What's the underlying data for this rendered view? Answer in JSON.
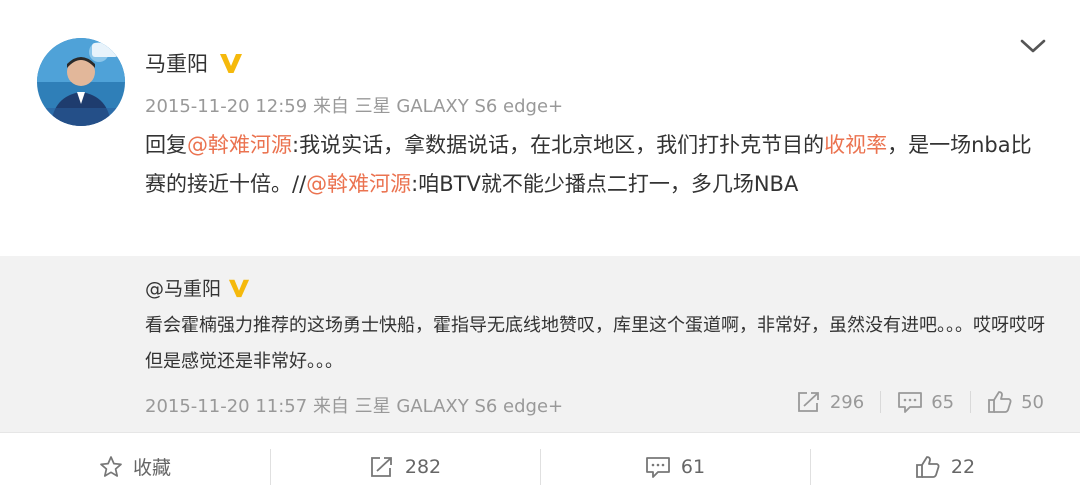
{
  "post": {
    "author": "马重阳",
    "timestamp": "2015-11-20 12:59",
    "source": "来自 三星 GALAXY S6 edge+",
    "text": {
      "reply_prefix": "回复",
      "mention1": "@斡难河源",
      "part1": ":我说实话，拿数据说话，在北京地区，我们打扑克节目的",
      "keyword": "收视率",
      "part2": "，是一场nba比赛的接近十倍。//",
      "mention2": "@斡难河源",
      "part3": ":咱BTV就不能少播点二打一，多几场NBA"
    }
  },
  "quoted": {
    "author": "@马重阳",
    "text": "看会霍楠强力推荐的这场勇士快船，霍指导无底线地赞叹，库里这个蛋道啊，非常好，虽然没有进吧。。。哎呀哎呀但是感觉还是非常好。。。",
    "timestamp": "2015-11-20 11:57",
    "source": "来自 三星 GALAXY S6 edge+",
    "repost_count": "296",
    "comment_count": "65",
    "like_count": "50"
  },
  "actions": {
    "favorite_label": "收藏",
    "repost_count": "282",
    "comment_count": "61",
    "like_count": "22"
  },
  "colors": {
    "accent": "#eb7350",
    "verified_badge": "#f5b90c",
    "quote_background": "#f2f2f2"
  },
  "icons": [
    "verified-v-icon",
    "chevron-down-icon",
    "repost-icon",
    "comment-icon",
    "like-icon",
    "star-icon"
  ]
}
